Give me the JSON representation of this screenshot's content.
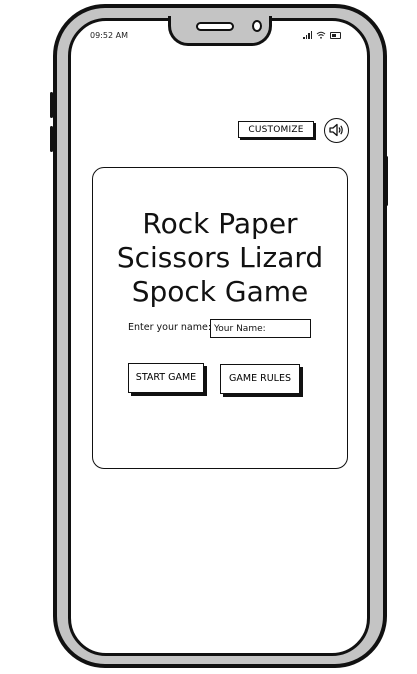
{
  "status_bar": {
    "time": "09:52 AM",
    "icons": [
      "signal-icon",
      "wifi-icon",
      "battery-icon"
    ]
  },
  "toolbar": {
    "customize_label": "CUSTOMIZE",
    "sound_icon": "speaker-icon"
  },
  "main": {
    "title_line1": "Rock Paper",
    "title_line2": "Scissors Lizard",
    "title_line3": "Spock Game",
    "name_label": "Enter your name:",
    "name_placeholder": "Your Name:",
    "start_label": "START GAME",
    "rules_label": "GAME RULES"
  },
  "colors": {
    "ink": "#111111",
    "frame": "#c4c4c4",
    "screen": "#ffffff"
  }
}
